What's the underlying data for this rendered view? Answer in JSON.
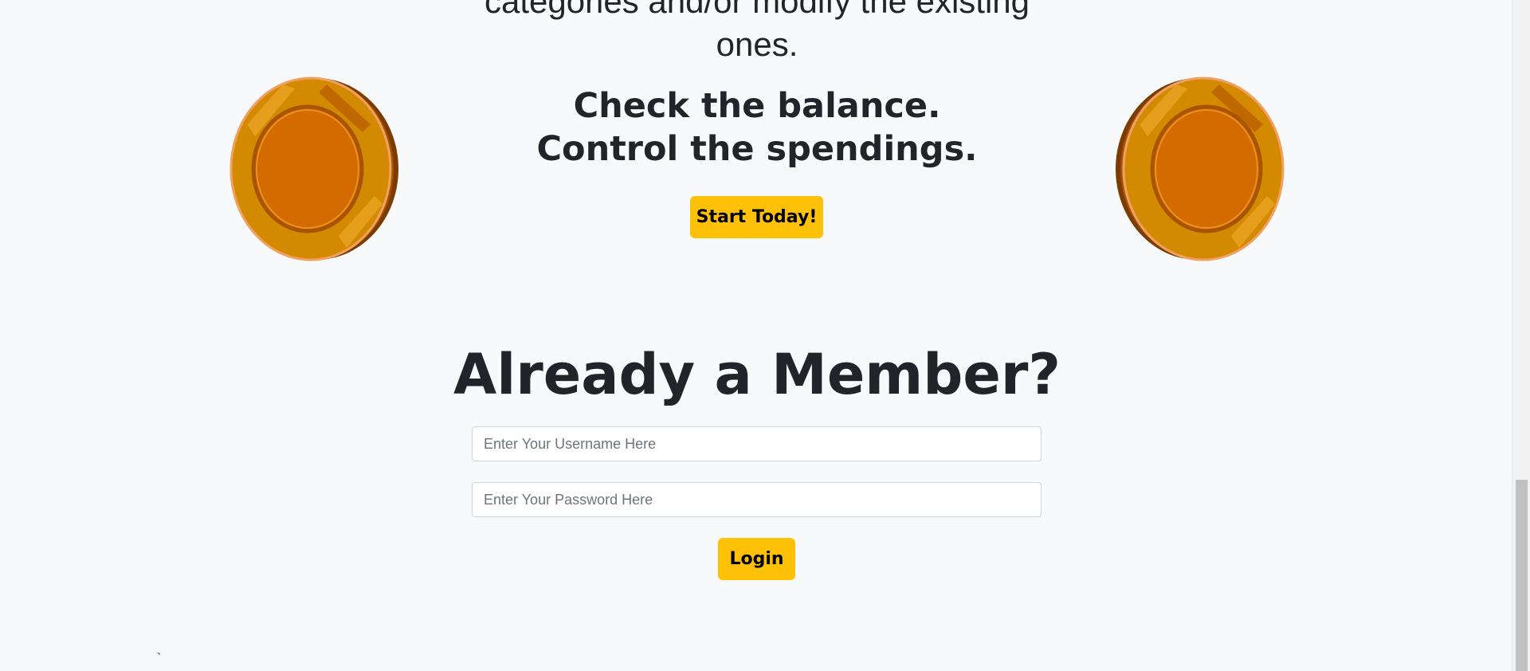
{
  "hero": {
    "intro_line_1": "categories and/or modify the existing",
    "intro_line_2": "ones.",
    "tagline_line_1": "Check the balance.",
    "tagline_line_2": "Control the spendings.",
    "start_button_label": "Start Today!"
  },
  "login": {
    "title": "Already a Member?",
    "username_placeholder": "Enter Your Username Here",
    "password_placeholder": "Enter Your Password Here",
    "login_button_label": "Login"
  },
  "footer": {
    "stray_mark": "`"
  },
  "colors": {
    "background": "#f8f9fa",
    "accent": "#ffc107",
    "text": "#212529",
    "coin_face": "#d46b00",
    "coin_edge": "#7a3c00",
    "coin_rim": "#e0a040"
  },
  "icons": {
    "coin_left": "coin-icon",
    "coin_right": "coin-icon"
  }
}
